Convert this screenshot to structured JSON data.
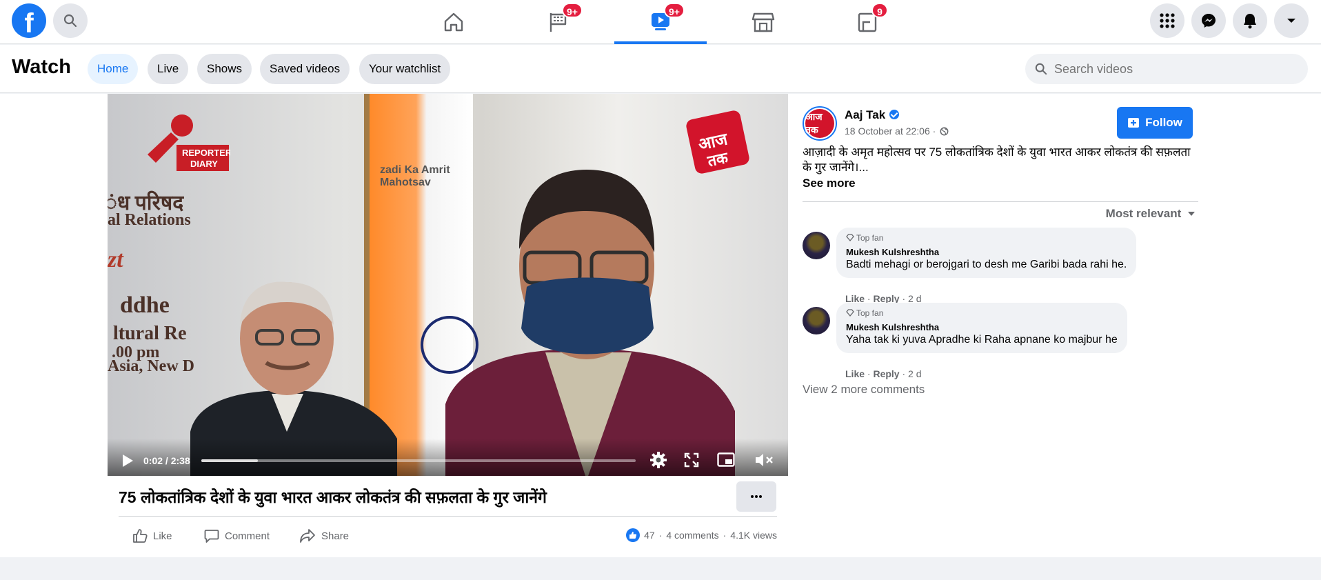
{
  "header": {
    "logo_letter": "f",
    "nav_badges": {
      "pages": "9+",
      "watch": "9+",
      "gaming": "9"
    }
  },
  "watch": {
    "title": "Watch",
    "tabs": [
      {
        "label": "Home",
        "active": true
      },
      {
        "label": "Live"
      },
      {
        "label": "Shows"
      },
      {
        "label": "Saved videos"
      },
      {
        "label": "Your watchlist"
      }
    ],
    "search_placeholder": "Search videos"
  },
  "video": {
    "logo_reporter": "REPORTER DIARY",
    "logo_aajtak": "आज तक",
    "background_text": [
      "ंध परिषद",
      "al Relations",
      "ddhe",
      "ltural Re",
      ".00 pm",
      "Asia, New D",
      "zt"
    ],
    "mahotsav_text": "zadi Ka Amrit Mahotsav",
    "time_current": "0:02",
    "time_total": "2:38",
    "progress_fraction": 0.13,
    "title": "75 लोकतांत्रिक देशों के युवा भारत आकर लोकतंत्र की सफ़लता के गुर जानेंगे",
    "actions": {
      "like": "Like",
      "comment": "Comment",
      "share": "Share"
    },
    "stats": {
      "reactions": "47",
      "comments": "4 comments",
      "views": "4.1K views"
    }
  },
  "post": {
    "page_name": "Aaj Tak",
    "avatar_text": "आज तक",
    "date": "18 October at 22:06 ·",
    "follow_label": "Follow",
    "description": "आज़ादी के अमृत महोत्सव पर 75 लोकतांत्रिक देशों के युवा भारत आकर लोकतंत्र की सफ़लता के गुर जानेंगे।...",
    "see_more": "See more",
    "sort_label": "Most relevant"
  },
  "comments": [
    {
      "badge": "Top fan",
      "author": "Mukesh Kulshreshtha",
      "text": "Badti mehagi or berojgari to desh me Garibi bada rahi he.",
      "like": "Like",
      "reply": "Reply",
      "age": "2 d"
    },
    {
      "badge": "Top fan",
      "author": "Mukesh Kulshreshtha",
      "text": "Yaha tak ki yuva Apradhe ki Raha apnane ko majbur he",
      "like": "Like",
      "reply": "Reply",
      "age": "2 d"
    }
  ],
  "view_more_comments": "View 2 more comments",
  "colors": {
    "accent": "#1877f2",
    "badge": "#e41e3f"
  }
}
